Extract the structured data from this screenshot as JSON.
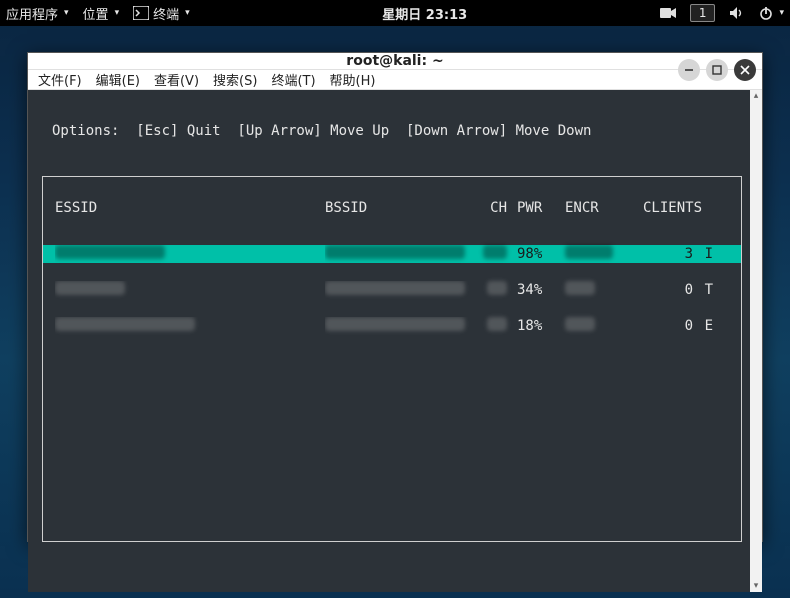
{
  "panel": {
    "apps": "应用程序",
    "places": "位置",
    "terminal": "终端",
    "clock": "星期日 23:13",
    "workspace": "1"
  },
  "window": {
    "title": "root@kali: ~",
    "menus": {
      "file": "文件(F)",
      "edit": "编辑(E)",
      "view": "查看(V)",
      "search": "搜索(S)",
      "terminal": "终端(T)",
      "help": "帮助(H)"
    }
  },
  "term": {
    "options_line": "Options:  [Esc] Quit  [Up Arrow] Move Up  [Down Arrow] Move Down",
    "headers": {
      "essid": "ESSID",
      "bssid": "BSSID",
      "ch": "CH",
      "pwr": "PWR",
      "encr": "ENCR",
      "clients": "CLIENTS"
    },
    "rows": [
      {
        "selected": true,
        "pwr": "98%",
        "clients": "3",
        "tail": "I"
      },
      {
        "selected": false,
        "pwr": "34%",
        "clients": "0",
        "tail": "T"
      },
      {
        "selected": false,
        "pwr": "18%",
        "clients": "0",
        "tail": "E"
      }
    ]
  }
}
